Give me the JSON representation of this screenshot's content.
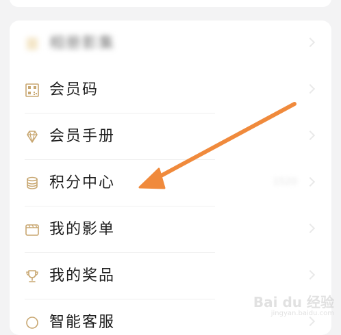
{
  "menu": {
    "items": [
      {
        "label": "相册影集",
        "icon": "album-icon",
        "blurred": true
      },
      {
        "label": "会员码",
        "icon": "qr-code-icon"
      },
      {
        "label": "会员手册",
        "icon": "diamond-icon"
      },
      {
        "label": "积分中心",
        "icon": "coin-stack-icon",
        "trailing": "1520"
      },
      {
        "label": "我的影单",
        "icon": "film-clapper-icon"
      },
      {
        "label": "我的奖品",
        "icon": "trophy-icon"
      },
      {
        "label": "智能客服",
        "icon": "service-icon"
      }
    ]
  },
  "annotation": {
    "arrow_color": "#f08a3c",
    "points_to": "积分中心"
  },
  "watermark": {
    "brand": "Bai du 经验",
    "url": "jingyan.baidu.com"
  },
  "colors": {
    "background": "#f3f3f4",
    "card": "#ffffff",
    "text": "#1f1f1f",
    "icon_gold": "#c8a771",
    "arrow": "#f08a3c"
  }
}
